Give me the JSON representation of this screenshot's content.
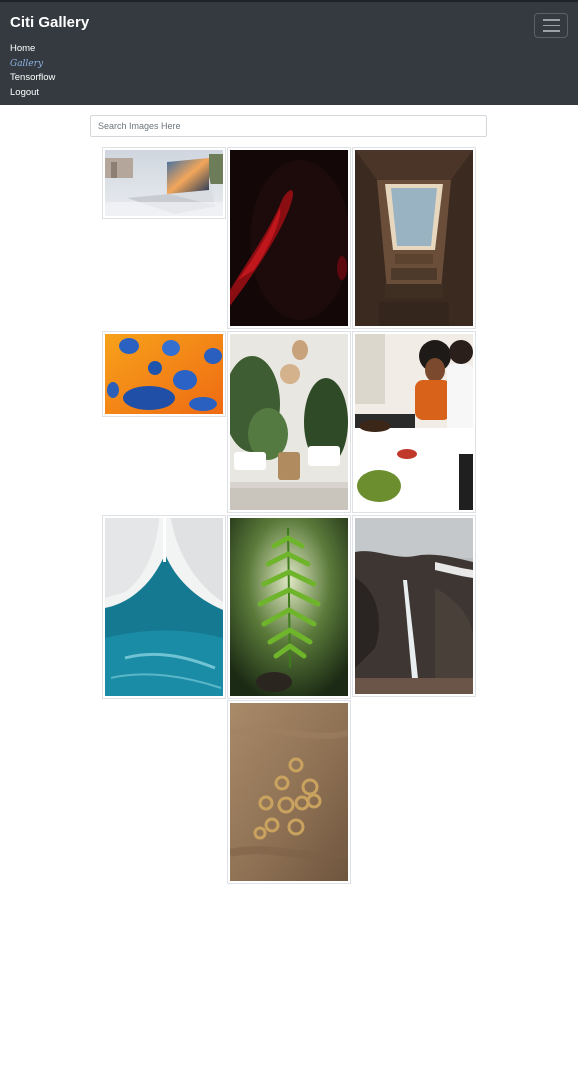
{
  "navbar": {
    "brand": "Citi Gallery",
    "toggle_icon": "hamburger-menu-icon",
    "links": [
      "Home",
      "Gallery",
      "Tensorflow",
      "Logout"
    ],
    "active_link": "Gallery",
    "background": "#343a40"
  },
  "search": {
    "placeholder": "Search Images Here",
    "value": ""
  },
  "gallery": {
    "images": [
      {
        "subject": "laptop-on-desk"
      },
      {
        "subject": "red-fabric-in-dark"
      },
      {
        "subject": "skylight-in-attic"
      },
      {
        "subject": "water-droplets-orange"
      },
      {
        "subject": "plants-living-room"
      },
      {
        "subject": "couple-cooking"
      },
      {
        "subject": "aerial-ocean-waves"
      },
      {
        "subject": "fern-leaf"
      },
      {
        "subject": "waterfall-cliff"
      },
      {
        "subject": "rings-on-fabric"
      }
    ]
  }
}
